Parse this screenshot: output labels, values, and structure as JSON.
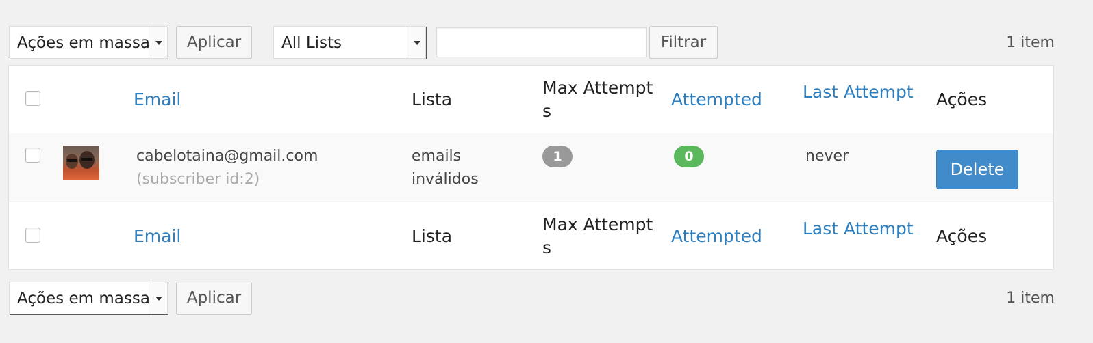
{
  "tablenav_top": {
    "bulk_actions": "Ações em massa",
    "apply": "Aplicar",
    "list_filter": "All Lists",
    "filter_input_value": "",
    "filter_button": "Filtrar",
    "item_count": "1 item"
  },
  "tablenav_bottom": {
    "bulk_actions": "Ações em massa",
    "apply": "Aplicar",
    "item_count": "1 item"
  },
  "columns": {
    "email": "Email",
    "list": "Lista",
    "max_attempts_line1": "Max Attempt",
    "max_attempts_line2": "s",
    "attempted": "Attempted",
    "last_attempt": "Last Attempt",
    "actions": "Ações"
  },
  "rows": [
    {
      "email": "cabelotaina@gmail.com",
      "subscriber_id": "(subscriber id:2)",
      "list_line1": "emails",
      "list_line2": "inválidos",
      "max_attempts": "1",
      "attempted": "0",
      "last_attempt": "never",
      "action": "Delete"
    }
  ],
  "colors": {
    "link": "#2e7fbf",
    "badge_gray": "#999999",
    "badge_green": "#5cb85c",
    "primary_button": "#428bca"
  },
  "icons": {
    "avatar": "user-photo"
  }
}
